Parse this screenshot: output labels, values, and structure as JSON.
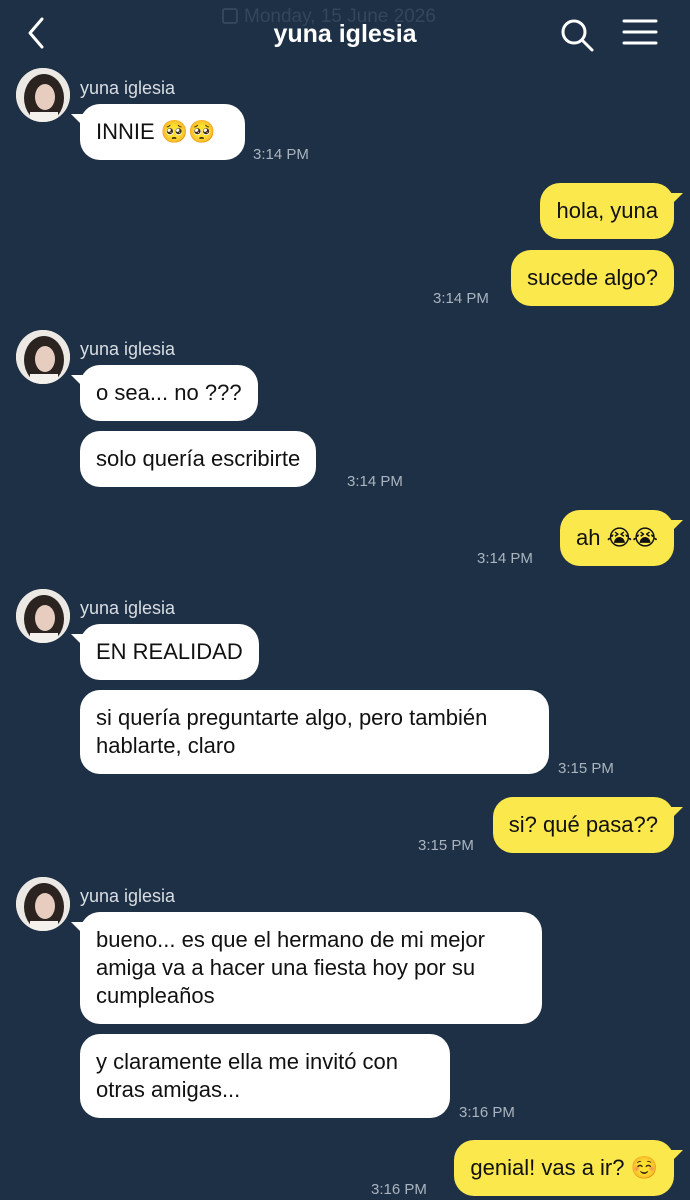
{
  "header": {
    "title": "yuna iglesia",
    "date_ghost": "Monday, 15 June 2026"
  },
  "icons": [
    "back-arrow-icon",
    "search-icon",
    "menu-icon",
    "avatar"
  ],
  "colors": {
    "background": "#1e3045",
    "incoming_bubble": "#ffffff",
    "outgoing_bubble": "#fbe84d",
    "timestamp": "#aab4bf"
  },
  "messages": [
    {
      "from": "yuna iglesia",
      "dir": "in",
      "text": "INNIE 🥺🥺",
      "time": "3:14 PM"
    },
    {
      "from": "me",
      "dir": "out",
      "text": "hola, yuna",
      "time": ""
    },
    {
      "from": "me",
      "dir": "out",
      "text": "sucede algo?",
      "time": "3:14 PM"
    },
    {
      "from": "yuna iglesia",
      "dir": "in",
      "text": "o sea... no ???",
      "time": ""
    },
    {
      "from": "yuna iglesia",
      "dir": "in",
      "text": "solo quería escribirte",
      "time": "3:14 PM"
    },
    {
      "from": "me",
      "dir": "out",
      "text": "ah 😭😭",
      "time": "3:14 PM"
    },
    {
      "from": "yuna iglesia",
      "dir": "in",
      "text": "EN REALIDAD",
      "time": ""
    },
    {
      "from": "yuna iglesia",
      "dir": "in",
      "text": "si quería preguntarte algo, pero también hablarte, claro",
      "time": "3:15 PM"
    },
    {
      "from": "me",
      "dir": "out",
      "text": "si? qué pasa??",
      "time": "3:15 PM"
    },
    {
      "from": "yuna iglesia",
      "dir": "in",
      "text": "bueno... es que el hermano de mi mejor amiga va a hacer una fiesta hoy por su cumpleaños",
      "time": ""
    },
    {
      "from": "yuna iglesia",
      "dir": "in",
      "text": "y claramente ella me invitó con otras amigas...",
      "time": "3:16 PM"
    },
    {
      "from": "me",
      "dir": "out",
      "text": "genial! vas a ir? ☺️",
      "time": "3:16 PM"
    }
  ]
}
